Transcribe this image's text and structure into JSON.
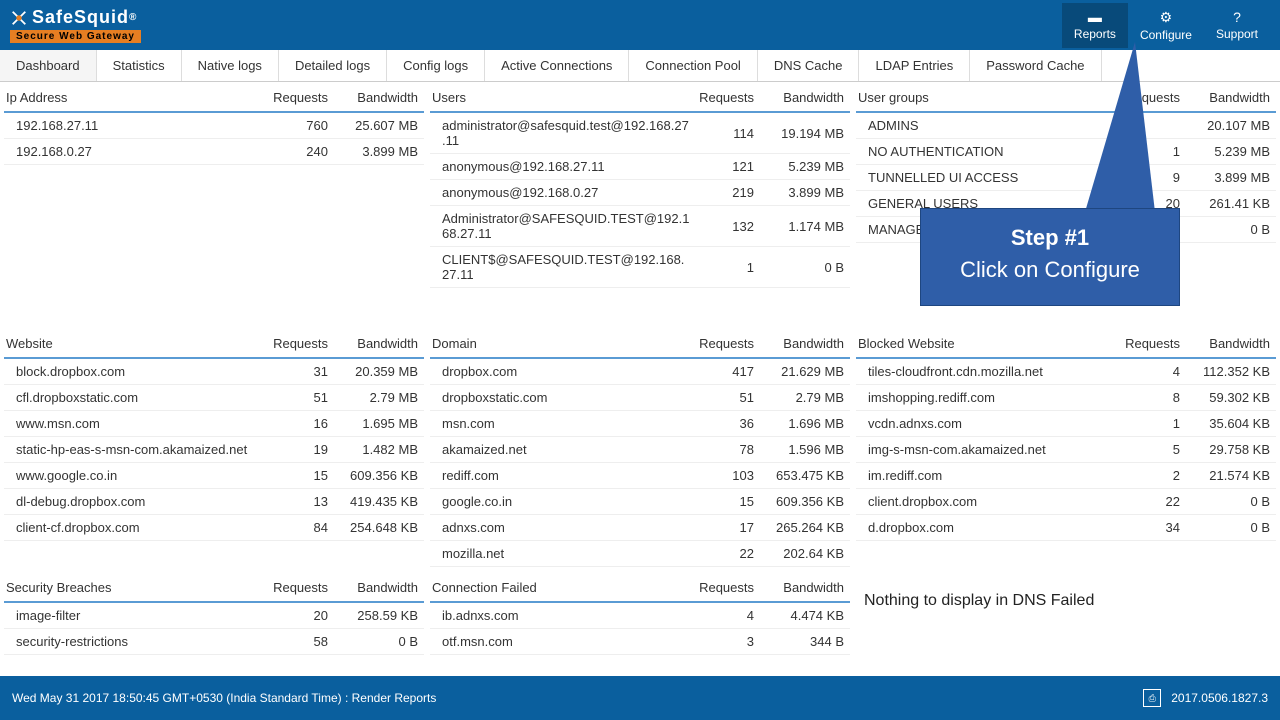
{
  "brand": {
    "name": "SafeSquid",
    "reg": "®",
    "tagline": "Secure Web Gateway"
  },
  "headerNav": [
    {
      "label": "Reports",
      "icon": "▬"
    },
    {
      "label": "Configure",
      "icon": "⚙"
    },
    {
      "label": "Support",
      "icon": "?"
    }
  ],
  "tabs": [
    "Dashboard",
    "Statistics",
    "Native logs",
    "Detailed logs",
    "Config logs",
    "Active Connections",
    "Connection Pool",
    "DNS Cache",
    "LDAP Entries",
    "Password Cache"
  ],
  "headers": {
    "requests": "Requests",
    "bandwidth": "Bandwidth"
  },
  "panels": {
    "ip": {
      "title": "Ip Address",
      "rows": [
        {
          "name": "192.168.27.11",
          "req": "760",
          "bw": "25.607 MB"
        },
        {
          "name": "192.168.0.27",
          "req": "240",
          "bw": "3.899 MB"
        }
      ]
    },
    "users": {
      "title": "Users",
      "rows": [
        {
          "name": "administrator@safesquid.test@192.168.27.11",
          "req": "114",
          "bw": "19.194 MB"
        },
        {
          "name": "anonymous@192.168.27.11",
          "req": "121",
          "bw": "5.239 MB"
        },
        {
          "name": "anonymous@192.168.0.27",
          "req": "219",
          "bw": "3.899 MB"
        },
        {
          "name": "Administrator@SAFESQUID.TEST@192.168.27.11",
          "req": "132",
          "bw": "1.174 MB"
        },
        {
          "name": "CLIENT$@SAFESQUID.TEST@192.168.27.11",
          "req": "1",
          "bw": "0 B"
        }
      ]
    },
    "groups": {
      "title": "User groups",
      "rows": [
        {
          "name": "ADMINS",
          "req": "",
          "bw": "20.107 MB"
        },
        {
          "name": "NO AUTHENTICATION",
          "req": "1",
          "bw": "5.239 MB"
        },
        {
          "name": "TUNNELLED UI ACCESS",
          "req": "9",
          "bw": "3.899 MB"
        },
        {
          "name": "GENERAL USERS",
          "req": "20",
          "bw": "261.41 KB"
        },
        {
          "name": "MANAGER",
          "req": "",
          "bw": "0 B"
        }
      ]
    },
    "website": {
      "title": "Website",
      "rows": [
        {
          "name": "block.dropbox.com",
          "req": "31",
          "bw": "20.359 MB"
        },
        {
          "name": "cfl.dropboxstatic.com",
          "req": "51",
          "bw": "2.79 MB"
        },
        {
          "name": "www.msn.com",
          "req": "16",
          "bw": "1.695 MB"
        },
        {
          "name": "static-hp-eas-s-msn-com.akamaized.net",
          "req": "19",
          "bw": "1.482 MB"
        },
        {
          "name": "www.google.co.in",
          "req": "15",
          "bw": "609.356 KB"
        },
        {
          "name": "dl-debug.dropbox.com",
          "req": "13",
          "bw": "419.435 KB"
        },
        {
          "name": "client-cf.dropbox.com",
          "req": "84",
          "bw": "254.648 KB"
        }
      ]
    },
    "domain": {
      "title": "Domain",
      "rows": [
        {
          "name": "dropbox.com",
          "req": "417",
          "bw": "21.629 MB"
        },
        {
          "name": "dropboxstatic.com",
          "req": "51",
          "bw": "2.79 MB"
        },
        {
          "name": "msn.com",
          "req": "36",
          "bw": "1.696 MB"
        },
        {
          "name": "akamaized.net",
          "req": "78",
          "bw": "1.596 MB"
        },
        {
          "name": "rediff.com",
          "req": "103",
          "bw": "653.475 KB"
        },
        {
          "name": "google.co.in",
          "req": "15",
          "bw": "609.356 KB"
        },
        {
          "name": "adnxs.com",
          "req": "17",
          "bw": "265.264 KB"
        },
        {
          "name": "mozilla.net",
          "req": "22",
          "bw": "202.64 KB"
        }
      ]
    },
    "blocked": {
      "title": "Blocked Website",
      "rows": [
        {
          "name": "tiles-cloudfront.cdn.mozilla.net",
          "req": "4",
          "bw": "112.352 KB"
        },
        {
          "name": "imshopping.rediff.com",
          "req": "8",
          "bw": "59.302 KB"
        },
        {
          "name": "vcdn.adnxs.com",
          "req": "1",
          "bw": "35.604 KB"
        },
        {
          "name": "img-s-msn-com.akamaized.net",
          "req": "5",
          "bw": "29.758 KB"
        },
        {
          "name": "im.rediff.com",
          "req": "2",
          "bw": "21.574 KB"
        },
        {
          "name": "client.dropbox.com",
          "req": "22",
          "bw": "0 B"
        },
        {
          "name": "d.dropbox.com",
          "req": "34",
          "bw": "0 B"
        }
      ]
    },
    "breaches": {
      "title": "Security Breaches",
      "rows": [
        {
          "name": "image-filter",
          "req": "20",
          "bw": "258.59 KB"
        },
        {
          "name": "security-restrictions",
          "req": "58",
          "bw": "0 B"
        }
      ]
    },
    "connfail": {
      "title": "Connection Failed",
      "rows": [
        {
          "name": "ib.adnxs.com",
          "req": "4",
          "bw": "4.474 KB"
        },
        {
          "name": "otf.msn.com",
          "req": "3",
          "bw": "344 B"
        }
      ]
    },
    "dnsfail": {
      "nothing": "Nothing to display in DNS Failed"
    }
  },
  "footer": {
    "left": "Wed May 31 2017 18:50:45 GMT+0530 (India Standard Time) : Render Reports",
    "version": "2017.0506.1827.3"
  },
  "callout": {
    "step": "Step #1",
    "text": "Click on Configure"
  }
}
